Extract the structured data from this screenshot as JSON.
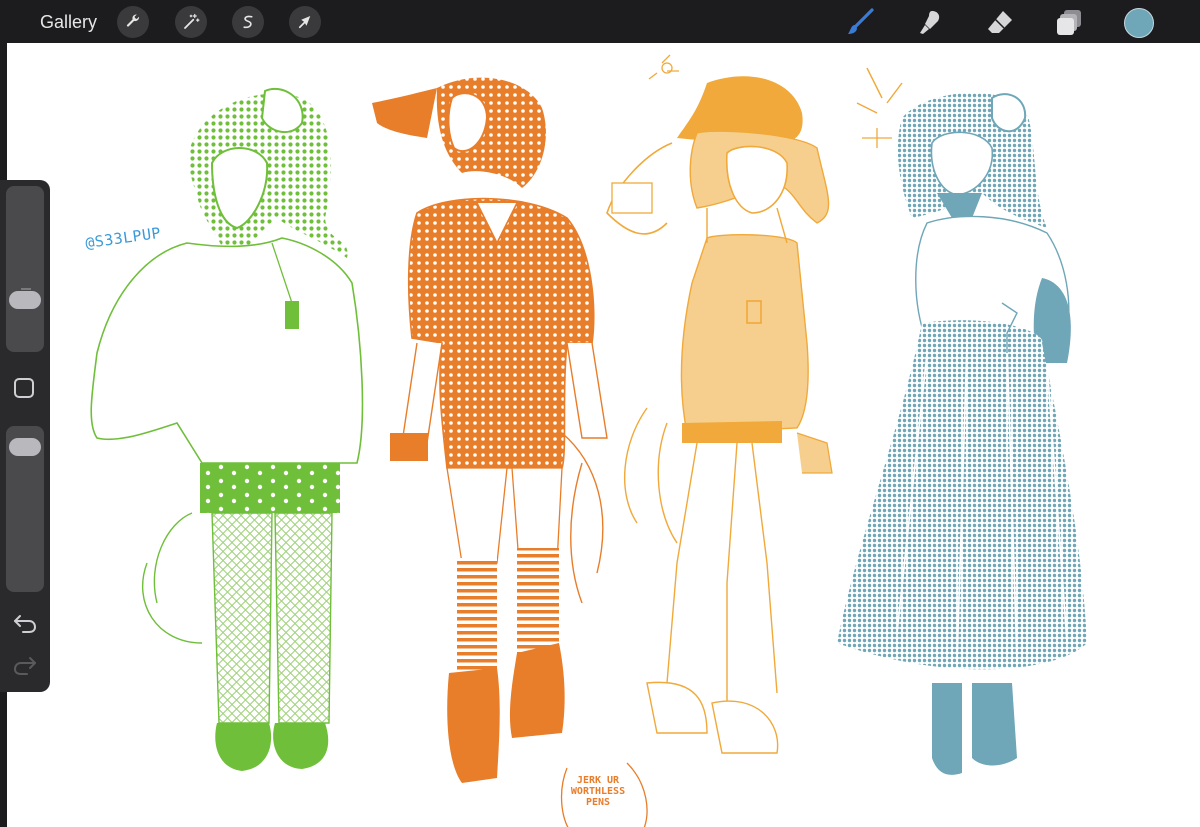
{
  "toolbar": {
    "gallery_label": "Gallery",
    "left_tools": [
      "wrench-icon",
      "magic-wand-icon",
      "selection-icon",
      "move-arrow-icon"
    ],
    "right_tools": [
      "brush-icon",
      "smudge-icon",
      "eraser-icon",
      "layers-icon"
    ],
    "current_color": "#6fa6b8",
    "accent": "#3a7bd5"
  },
  "sidebar": {
    "brush_size_level": 0.28,
    "opacity_level": 0.06
  },
  "canvas": {
    "signature": "@S33LPUP",
    "speech_text": "JERK UR WORTHLESS PENS",
    "palette": {
      "green": "#6fbf3a",
      "orange": "#e87d2a",
      "yellow": "#f0a93a",
      "blue": "#6fa6b8"
    }
  }
}
